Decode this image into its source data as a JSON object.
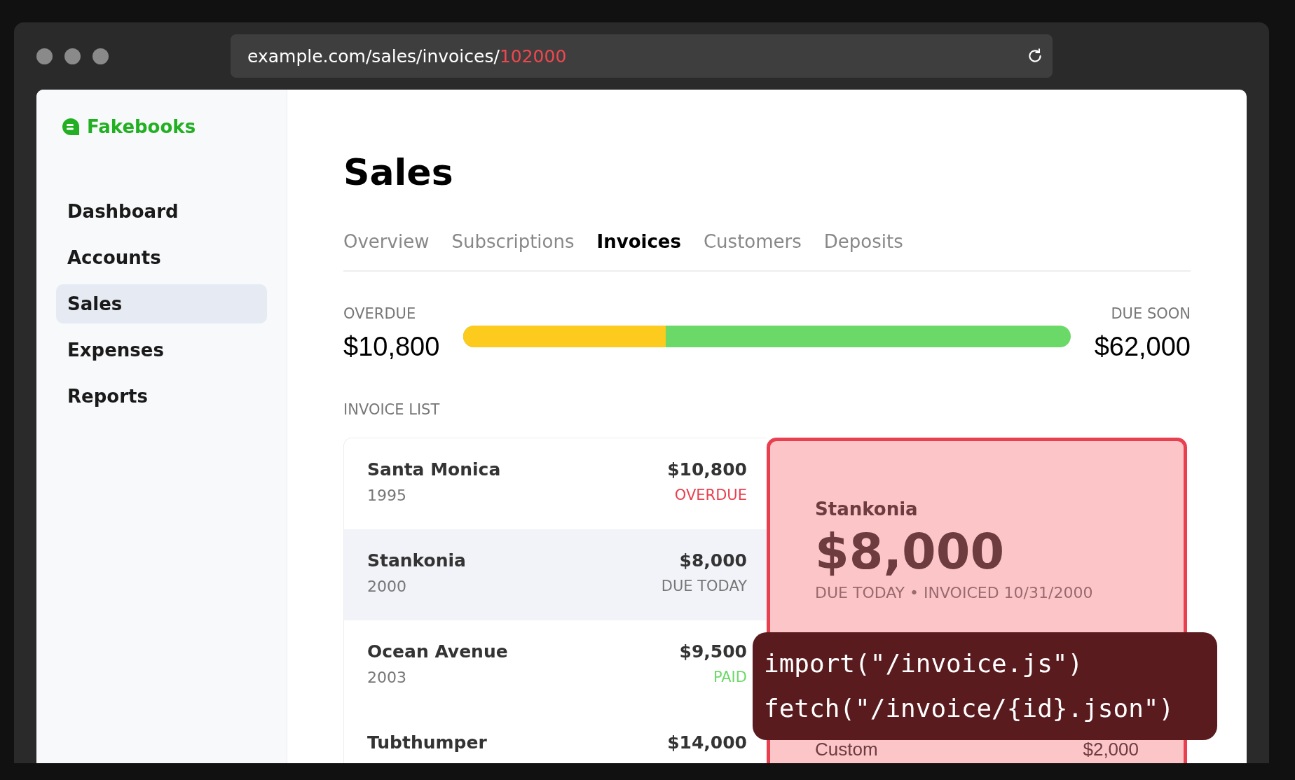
{
  "browser": {
    "url_path": "example.com/sales/invoices/",
    "url_id": "102000"
  },
  "sidebar": {
    "logo": "Fakebooks",
    "items": [
      {
        "label": "Dashboard",
        "selected": false
      },
      {
        "label": "Accounts",
        "selected": false
      },
      {
        "label": "Sales",
        "selected": true
      },
      {
        "label": "Expenses",
        "selected": false
      },
      {
        "label": "Reports",
        "selected": false
      }
    ]
  },
  "page_title": "Sales",
  "tabs": [
    {
      "label": "Overview",
      "selected": false
    },
    {
      "label": "Subscriptions",
      "selected": false
    },
    {
      "label": "Invoices",
      "selected": true
    },
    {
      "label": "Customers",
      "selected": false
    },
    {
      "label": "Deposits",
      "selected": false
    }
  ],
  "summary": {
    "overdue_label": "OVERDUE",
    "overdue_amount": "$10,800",
    "due_soon_label": "DUE SOON",
    "due_soon_amount": "$62,000",
    "level": 0.333
  },
  "invoice_list": {
    "heading": "INVOICE LIST",
    "rows": [
      {
        "name": "Santa Monica",
        "year": "1995",
        "amount": "$10,800",
        "status": "OVERDUE",
        "kind": "overdue",
        "selected": false
      },
      {
        "name": "Stankonia",
        "year": "2000",
        "amount": "$8,000",
        "status": "DUE TODAY",
        "kind": "due",
        "selected": true
      },
      {
        "name": "Ocean Avenue",
        "year": "2003",
        "amount": "$9,500",
        "status": "PAID",
        "kind": "paid",
        "selected": false
      },
      {
        "name": "Tubthumper",
        "amount": "$14,000",
        "selected": false
      }
    ]
  },
  "detail": {
    "name": "Stankonia",
    "amount": "$8,000",
    "subtitle": "DUE TODAY • INVOICED 10/31/2000",
    "line_items": [
      {
        "label": "Custom",
        "amount": "$2,000"
      }
    ]
  },
  "code_overlay": {
    "lines": [
      "import(\"/invoice.js\")",
      "fetch(\"/invoice/{id}.json\")"
    ]
  }
}
